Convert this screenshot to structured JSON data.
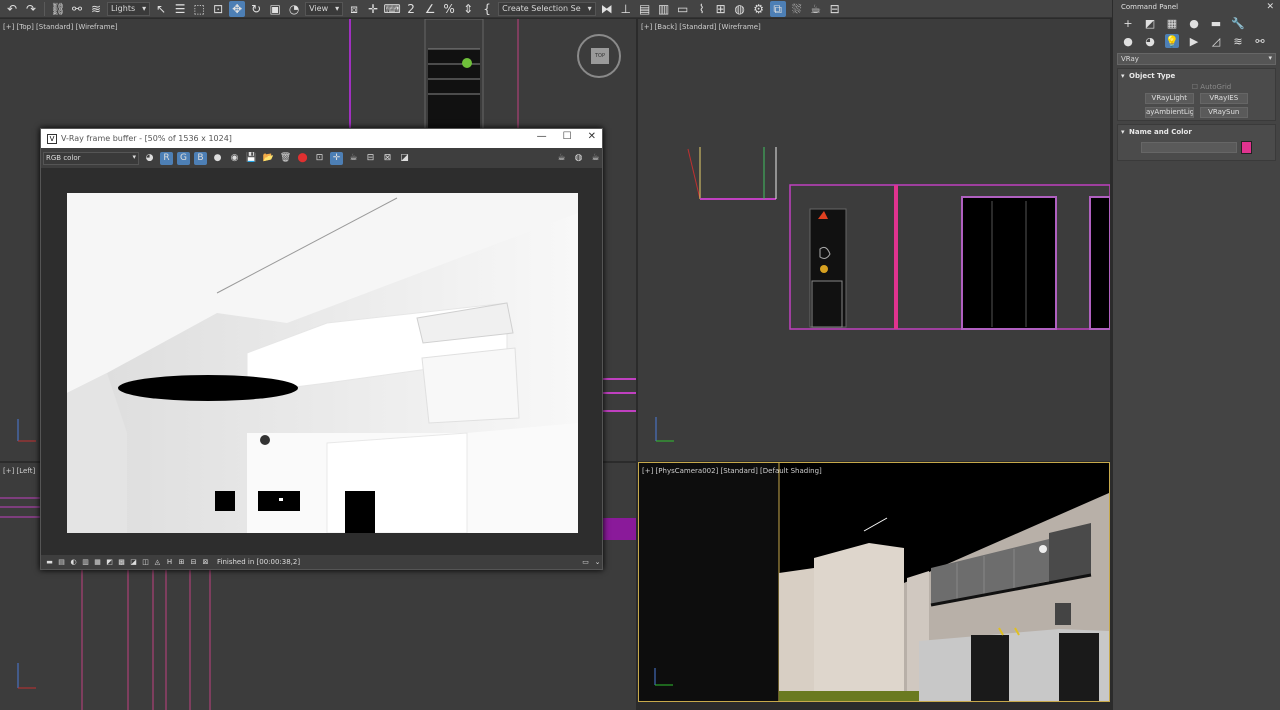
{
  "toolbar": {
    "filter_dropdown": "Lights",
    "coord_dropdown": "View",
    "selection_set": "Create Selection Se"
  },
  "viewports": {
    "top": "[+] [Top] [Standard] [Wireframe]",
    "back": "[+] [Back] [Standard] [Wireframe]",
    "left": "[+] [Left]",
    "camera": "[+] [PhysCamera002] [Standard] [Default Shading]"
  },
  "viewcube": {
    "face": "TOP"
  },
  "command_panel": {
    "title": "Command Panel",
    "category_dropdown": "VRay",
    "object_type": {
      "title": "Object Type",
      "autogrid": "AutoGrid",
      "buttons": [
        "VRayLight",
        "VRayIES",
        "ayAmbientLig",
        "VRaySun"
      ]
    },
    "name_and_color": {
      "title": "Name and Color",
      "color": "#e0338f"
    }
  },
  "vfb": {
    "title": "V-Ray frame buffer - [50% of 1536 x 1024]",
    "channel": "RGB color",
    "status": "Finished in [00:00:38,2]"
  },
  "colors": {
    "wire_magenta": "#c040c0",
    "wire_pink": "#e0338f",
    "active_blue": "#4d7fb5",
    "viewport_border": "#c7a94b"
  }
}
